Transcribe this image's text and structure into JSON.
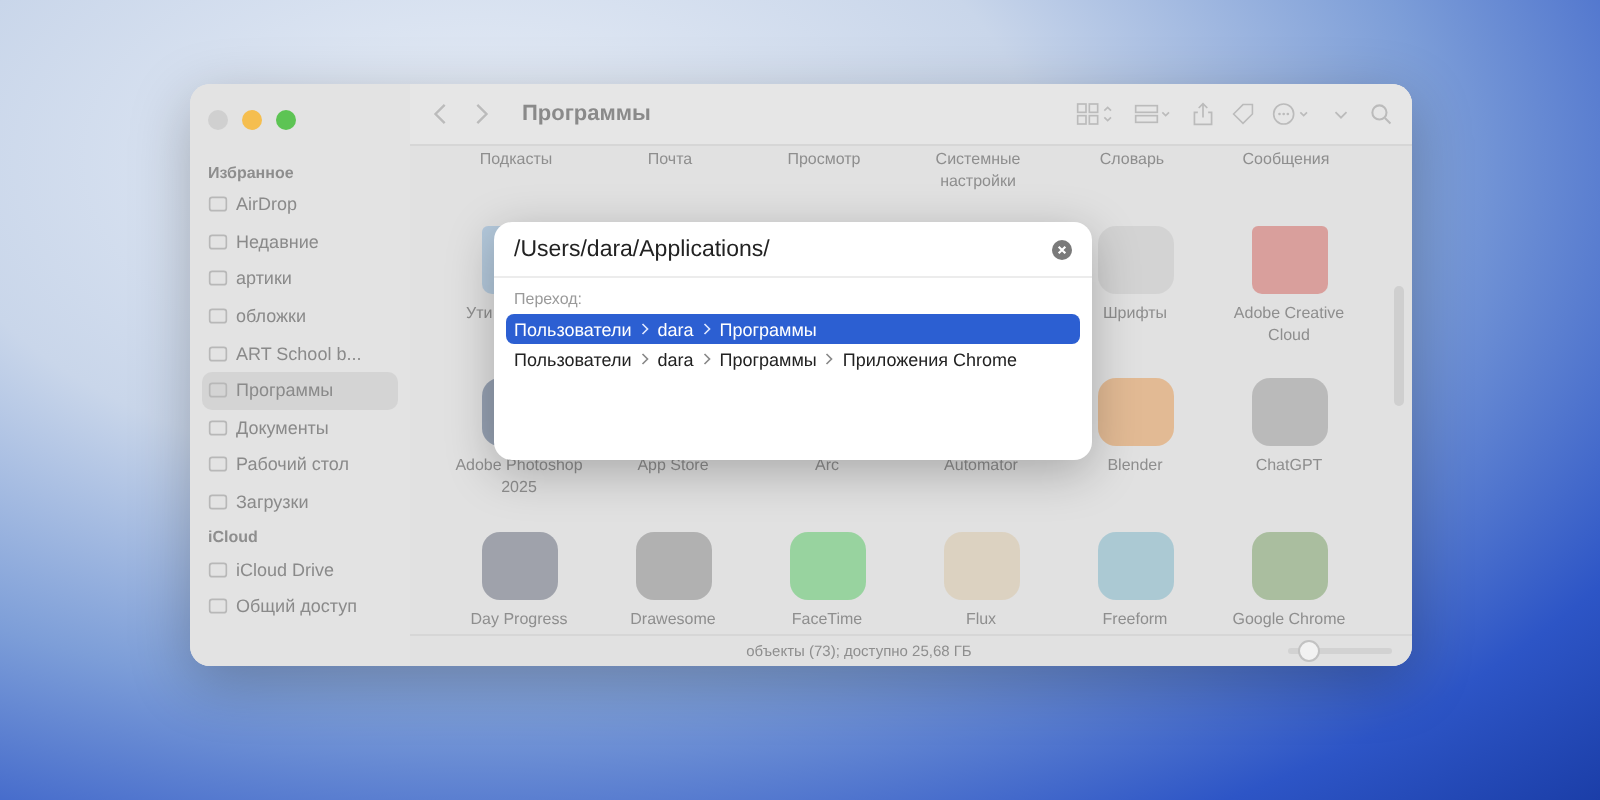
{
  "window": {
    "title": "Программы"
  },
  "sidebar": {
    "sections": [
      {
        "heading": "Избранное",
        "items": [
          {
            "label": "AirDrop",
            "selected": false
          },
          {
            "label": "Недавние",
            "selected": false
          },
          {
            "label": "артики",
            "selected": false
          },
          {
            "label": "обложки",
            "selected": false
          },
          {
            "label": "ART School b...",
            "selected": false
          },
          {
            "label": "Программы",
            "selected": true
          },
          {
            "label": "Документы",
            "selected": false
          },
          {
            "label": "Рабочий стол",
            "selected": false
          },
          {
            "label": "Загрузки",
            "selected": false
          }
        ]
      },
      {
        "heading": "iCloud",
        "items": [
          {
            "label": "iCloud Drive",
            "selected": false
          },
          {
            "label": "Общий доступ",
            "selected": false
          }
        ]
      }
    ]
  },
  "grid": {
    "top_labels": [
      "Подкасты",
      "Почта",
      "Просмотр",
      "Системные настройки",
      "Словарь",
      "Сообщения"
    ],
    "rows": [
      [
        {
          "label": "Ути"
        },
        {},
        {},
        {},
        {
          "label": "Шрифты"
        },
        {
          "label": "Adobe Creative Cloud"
        }
      ],
      [
        {
          "label": "Adobe Photoshop 2025"
        },
        {
          "label": "App Store"
        },
        {
          "label": "Arc"
        },
        {
          "label": "Automator"
        },
        {
          "label": "Blender"
        },
        {
          "label": "ChatGPT"
        }
      ],
      [
        {
          "label": "Day Progress"
        },
        {
          "label": "Drawesome"
        },
        {
          "label": "FaceTime"
        },
        {
          "label": "Flux"
        },
        {
          "label": "Freeform"
        },
        {
          "label": "Google Chrome"
        }
      ]
    ]
  },
  "status_bar": {
    "text": "объекты (73); доступно 25,68 ГБ",
    "zoom": {
      "level": 0.22
    }
  },
  "go_dialog": {
    "value": "/Users/dara/Applications/",
    "heading": "Переход:",
    "suggestions": [
      {
        "crumbs": [
          "Пользователи",
          "dara",
          "Программы"
        ],
        "selected": true
      },
      {
        "crumbs": [
          "Пользователи",
          "dara",
          "Программы",
          "Приложения Chrome"
        ],
        "selected": false
      }
    ]
  }
}
